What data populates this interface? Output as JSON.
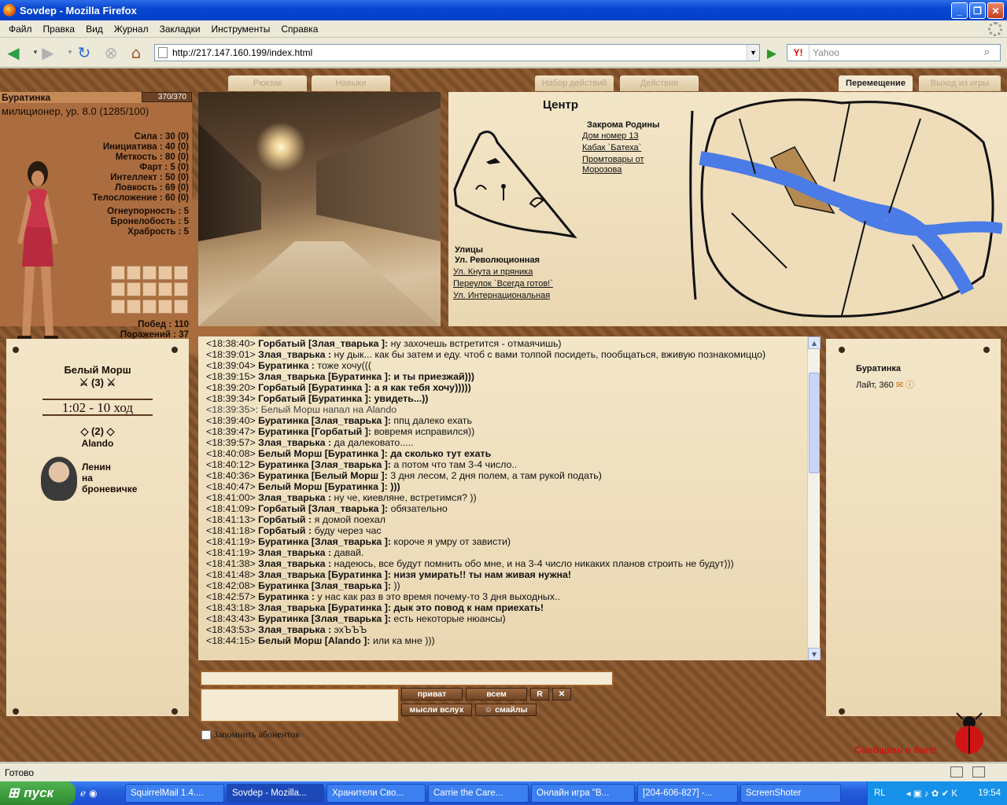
{
  "window": {
    "title": "Sovdep - Mozilla Firefox"
  },
  "menu": [
    "Файл",
    "Правка",
    "Вид",
    "Журнал",
    "Закладки",
    "Инструменты",
    "Справка"
  ],
  "nav": {
    "url": "http://217.147.160.199/index.html",
    "search_placeholder": "Yahoo",
    "search_engine": "Y!"
  },
  "tabs": [
    {
      "label": "Рюкзак",
      "active": false
    },
    {
      "label": "Навыки",
      "active": false
    },
    {
      "label": "Набор действий",
      "active": false
    },
    {
      "label": "Действия",
      "active": false
    },
    {
      "label": "Перемещение",
      "active": true
    },
    {
      "label": "Выход из игры",
      "active": false
    }
  ],
  "character": {
    "name": "Буратинка",
    "hp": "370/370",
    "rank": "милиционер, ур. 8.0 (1285/100)",
    "stats": [
      {
        "label": "Сила",
        "value": "30 (0)"
      },
      {
        "label": "Инициатива",
        "value": "40 (0)"
      },
      {
        "label": "Меткость",
        "value": "80 (0)"
      },
      {
        "label": "Фарт",
        "value": "5 (0)"
      },
      {
        "label": "Интеллект",
        "value": "50 (0)"
      },
      {
        "label": "Ловкость",
        "value": "69 (0)"
      },
      {
        "label": "Телосложение",
        "value": "60 (0)"
      }
    ],
    "resists": [
      {
        "label": "Огнеупорность",
        "value": "5"
      },
      {
        "label": "Бронелобость",
        "value": "5"
      },
      {
        "label": "Храбрость",
        "value": "5"
      }
    ],
    "wins": {
      "label": "Побед",
      "value": "110"
    },
    "losses": {
      "label": "Поражений",
      "value": "37"
    }
  },
  "city": {
    "title": "Центр",
    "region": "Закрома Родины",
    "buildings": [
      "Дом номер 13",
      "Кабак `Батеха`",
      "Промтовары от",
      "Морозова"
    ],
    "streets_header": "Улицы",
    "current_street": "Ул. Революционная",
    "streets": [
      "Ул. Кнута и пряника",
      "Переулок `Всегда готов!`",
      "Ул. Интернациональная"
    ]
  },
  "battle": {
    "opponent": "Белый Морш",
    "opponent_count": "(3)",
    "timer": "1:02 - 10 ход",
    "ally_count": "(2)",
    "ally": "Alando",
    "leader_lines": [
      "Ленин",
      "на",
      "броневичке"
    ]
  },
  "chat": [
    {
      "t": "<18:38:40>",
      "who": "Горбатый [Злая_тварька ]:",
      "msg": "ну захочешь встретится - отмаячишь)",
      "bold": false
    },
    {
      "t": "<18:39:01>",
      "who": "Злая_тварька :",
      "msg": "ну дык... как бы затем и еду. чтоб с вами толпой посидеть, пообщаться, вживую познакомиццо)",
      "bold": false
    },
    {
      "t": "<18:39:04>",
      "who": "Буратинка :",
      "msg": "тоже хочу(((",
      "bold": false
    },
    {
      "t": "<18:39:15>",
      "who": "Злая_тварька [Буратинка ]:",
      "msg": "и ты приезжай)))",
      "bold": true
    },
    {
      "t": "<18:39:20>",
      "who": "Горбатый [Буратинка ]:",
      "msg": "а я как тебя хочу)))))",
      "bold": true
    },
    {
      "t": "<18:39:34>",
      "who": "Горбатый [Буратинка ]:",
      "msg": "увидеть...))",
      "bold": true
    },
    {
      "t": "<18:39:35>:",
      "who": "",
      "msg": "Белый Морш напал на Alando",
      "bold": false,
      "sys": true
    },
    {
      "t": "<18:39:40>",
      "who": "Буратинка [Злая_тварька ]:",
      "msg": "ппц далеко ехать",
      "bold": false
    },
    {
      "t": "<18:39:47>",
      "who": "Буратинка [Горбатый ]:",
      "msg": "вовремя исправился))",
      "bold": false
    },
    {
      "t": "<18:39:57>",
      "who": "Злая_тварька :",
      "msg": "да далековато.....",
      "bold": false
    },
    {
      "t": "<18:40:08>",
      "who": "Белый Морш [Буратинка ]:",
      "msg": "да сколько тут ехать",
      "bold": true
    },
    {
      "t": "<18:40:12>",
      "who": "Буратинка [Злая_тварька ]:",
      "msg": "а потом что там 3-4 число..",
      "bold": false
    },
    {
      "t": "<18:40:36>",
      "who": "Буратинка [Белый Морш ]:",
      "msg": "3 дня лесом, 2 дня полем, а там рукой подать)",
      "bold": false
    },
    {
      "t": "<18:40:47>",
      "who": "Белый Морш [Буратинка ]:",
      "msg": ")))",
      "bold": true
    },
    {
      "t": "<18:41:00>",
      "who": "Злая_тварька :",
      "msg": "ну че, киевляне, встретимся? ))",
      "bold": false
    },
    {
      "t": "<18:41:09>",
      "who": "Горбатый [Злая_тварька ]:",
      "msg": "обязательно",
      "bold": false
    },
    {
      "t": "<18:41:13>",
      "who": "Горбатый :",
      "msg": "я домой поехал",
      "bold": false
    },
    {
      "t": "<18:41:18>",
      "who": "Горбатый :",
      "msg": "буду через час",
      "bold": false
    },
    {
      "t": "<18:41:19>",
      "who": "Буратинка [Злая_тварька ]:",
      "msg": "короче я умру от зависти)",
      "bold": false
    },
    {
      "t": "<18:41:19>",
      "who": "Злая_тварька :",
      "msg": "давай.",
      "bold": false
    },
    {
      "t": "<18:41:38>",
      "who": "Злая_тварька :",
      "msg": "надеюсь, все будут помнить обо мне, и на 3-4 число никаких планов строить не будут)))",
      "bold": false
    },
    {
      "t": "<18:41:48>",
      "who": "Злая_тварька [Буратинка ]:",
      "msg": "низя умирать!! ты нам живая нужна!",
      "bold": true
    },
    {
      "t": "<18:42:08>",
      "who": "Буратинка [Злая_тварька ]:",
      "msg": "))",
      "bold": false
    },
    {
      "t": "<18:42:57>",
      "who": "Буратинка :",
      "msg": "у нас как раз в это время почему-то 3 дня выходных..",
      "bold": false
    },
    {
      "t": "<18:43:18>",
      "who": "Злая_тварька [Буратинка ]:",
      "msg": "дык это повод к нам приехать!",
      "bold": true
    },
    {
      "t": "<18:43:43>",
      "who": "Буратинка [Злая_тварька ]:",
      "msg": "есть некоторые нюансы)",
      "bold": false
    },
    {
      "t": "<18:43:53>",
      "who": "Злая_тварька :",
      "msg": "эхЪЪЪ",
      "bold": false
    },
    {
      "t": "<18:44:15>",
      "who": "Белый Морш [Alando ]:",
      "msg": "или ка мне )))",
      "bold": false
    }
  ],
  "online": {
    "user": "Буратинка",
    "info": "Лайт, 360"
  },
  "chat_controls": {
    "private": "приват",
    "all": "всем",
    "thoughts": "мысли вслух",
    "smiles": "☺ смайлы",
    "remember": "Запомнить абонентов"
  },
  "bug_report": "Сообщить о баге!",
  "status": "Готово",
  "taskbar": {
    "start": "пуск",
    "tasks": [
      "SquirrelMail 1.4....",
      "Sovdep - Mozilla...",
      "Хранители Сво...",
      "Carrie the Care...",
      "Онлайн игра \"В...",
      "[204-606-827] -...",
      "ScreenShoter"
    ],
    "lang": "RL",
    "clock": "19:54"
  },
  "colors": {
    "accent": "#0a46d0",
    "rust": "#8a5a32",
    "paper": "#f0e2c3",
    "bug": "#d61010"
  }
}
